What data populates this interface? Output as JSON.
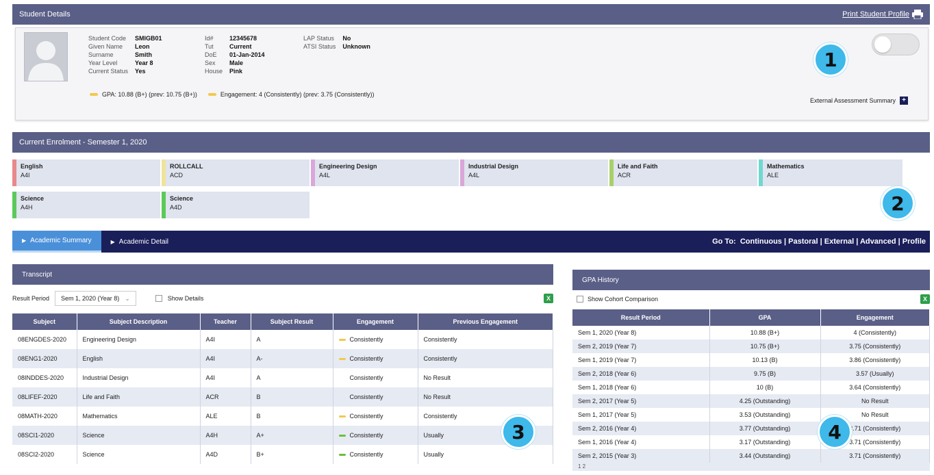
{
  "student_details": {
    "title": "Student Details",
    "print_link": "Print Student Profile",
    "col1": [
      {
        "k": "Student Code",
        "v": "SMIGB01"
      },
      {
        "k": "Given Name",
        "v": "Leon"
      },
      {
        "k": "Surname",
        "v": "Smith"
      },
      {
        "k": "Year Level",
        "v": "Year 8"
      },
      {
        "k": "Current Status",
        "v": "Yes"
      }
    ],
    "col2": [
      {
        "k": "Id#",
        "v": "12345678"
      },
      {
        "k": "Tut",
        "v": "Current"
      },
      {
        "k": "DoE",
        "v": "01-Jan-2014"
      },
      {
        "k": "Sex",
        "v": "Male"
      },
      {
        "k": "House",
        "v": "Pink"
      }
    ],
    "col3": [
      {
        "k": "LAP Status",
        "v": "No"
      },
      {
        "k": "ATSI Status",
        "v": "Unknown"
      }
    ],
    "gpa_text": "GPA: 10.88 (B+)   (prev: 10.75 (B+))",
    "engagement_text": "Engagement: 4 (Consistently)   (prev: 3.75 (Consistently))",
    "external_link": "External Assessment Summary",
    "expand_icon_glyph": "+"
  },
  "badges": [
    "1",
    "2",
    "3",
    "4"
  ],
  "enrolment": {
    "title": "Current Enrolment - Semester 1, 2020",
    "subjects": [
      {
        "name": "English",
        "code": "A4I",
        "color": "#e8898a"
      },
      {
        "name": "ROLLCALL",
        "code": "ACD",
        "color": "#efe39a"
      },
      {
        "name": "Engineering Design",
        "code": "A4L",
        "color": "#d9a7d9"
      },
      {
        "name": "Industrial Design",
        "code": "A4L",
        "color": "#d9a7d9"
      },
      {
        "name": "Life and Faith",
        "code": "ACR",
        "color": "#a8d06a"
      },
      {
        "name": "Mathematics",
        "code": "ALE",
        "color": "#6fd8d0"
      },
      {
        "name": "Science",
        "code": "A4H",
        "color": "#5cc95a"
      },
      {
        "name": "Science",
        "code": "A4D",
        "color": "#5cc95a"
      }
    ]
  },
  "tabs": {
    "summary": "Academic Summary",
    "detail": "Academic Detail",
    "goto_label": "Go To:",
    "goto_links": [
      "Continuous",
      "Pastoral",
      "External",
      "Advanced",
      "Profile"
    ]
  },
  "transcript": {
    "title": "Transcript",
    "result_period_label": "Result Period",
    "result_period_value": "Sem 1, 2020 (Year 8)",
    "show_label": "Show Details",
    "headers": [
      "Subject",
      "Subject Description",
      "Teacher",
      "Subject Result",
      "Engagement",
      "Previous Engagement"
    ],
    "rows": [
      {
        "subject": "08ENGDES-2020",
        "desc": "Engineering Design",
        "teacher": "A4I",
        "result": "A",
        "eng": "Consistently",
        "eng_color": "#f2c94c",
        "prev": "Consistently"
      },
      {
        "subject": "08ENG1-2020",
        "desc": "English",
        "teacher": "A4I",
        "result": "A-",
        "eng": "Consistently",
        "eng_color": "#f2c94c",
        "prev": "Consistently"
      },
      {
        "subject": "08INDDES-2020",
        "desc": "Industrial Design",
        "teacher": "A4I",
        "result": "A",
        "eng": "Consistently",
        "eng_color": "",
        "prev": "No Result"
      },
      {
        "subject": "08LIFEF-2020",
        "desc": "Life and Faith",
        "teacher": "ACR",
        "result": "B",
        "eng": "Consistently",
        "eng_color": "",
        "prev": "No Result"
      },
      {
        "subject": "08MATH-2020",
        "desc": "Mathematics",
        "teacher": "ALE",
        "result": "B",
        "eng": "Consistently",
        "eng_color": "#f2c94c",
        "prev": "Consistently"
      },
      {
        "subject": "08SCI1-2020",
        "desc": "Science",
        "teacher": "A4H",
        "result": "A+",
        "eng": "Consistently",
        "eng_color": "#6bbf3a",
        "prev": "Usually"
      },
      {
        "subject": "08SCI2-2020",
        "desc": "Science",
        "teacher": "A4D",
        "result": "B+",
        "eng": "Consistently",
        "eng_color": "#6bbf3a",
        "prev": "Usually"
      }
    ],
    "export_icon": "excel-icon"
  },
  "gpa_history": {
    "title": "GPA History",
    "show_label": "Show Cohort Comparison",
    "headers": [
      "Result Period",
      "GPA",
      "Engagement"
    ],
    "rows": [
      {
        "period": "Sem 1, 2020 (Year 8)",
        "gpa": "10.88 (B+)",
        "eng": "4 (Consistently)"
      },
      {
        "period": "Sem 2, 2019 (Year 7)",
        "gpa": "10.75 (B+)",
        "eng": "3.75 (Consistently)"
      },
      {
        "period": "Sem 1, 2019 (Year 7)",
        "gpa": "10.13 (B)",
        "eng": "3.86 (Consistently)"
      },
      {
        "period": "Sem 2, 2018 (Year 6)",
        "gpa": "9.75 (B)",
        "eng": "3.57 (Usually)"
      },
      {
        "period": "Sem 1, 2018 (Year 6)",
        "gpa": "10 (B)",
        "eng": "3.64 (Consistently)"
      },
      {
        "period": "Sem 2, 2017 (Year 5)",
        "gpa": "4.25 (Outstanding)",
        "eng": "No Result"
      },
      {
        "period": "Sem 1, 2017 (Year 5)",
        "gpa": "3.53 (Outstanding)",
        "eng": "No Result"
      },
      {
        "period": "Sem 2, 2016 (Year 4)",
        "gpa": "3.77 (Outstanding)",
        "eng": "3.71 (Consistently)"
      },
      {
        "period": "Sem 1, 2016 (Year 4)",
        "gpa": "3.17 (Outstanding)",
        "eng": "3.71 (Consistently)"
      },
      {
        "period": "Sem 2, 2015 (Year 3)",
        "gpa": "3.44 (Outstanding)",
        "eng": "3.71 (Consistently)"
      }
    ],
    "pager": "1 2"
  }
}
